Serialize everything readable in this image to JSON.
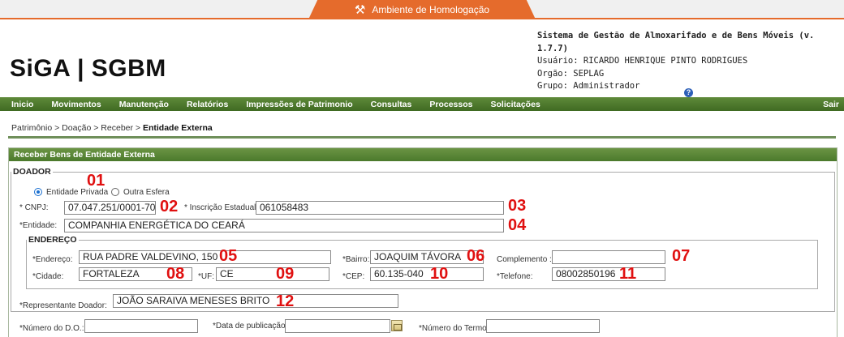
{
  "env_banner": "Ambiente de Homologação",
  "logo": "SiGA | SGBM",
  "system": {
    "title": "Sistema de Gestão de Almoxarifado e de Bens Móveis (v. 1.7.7)",
    "usuario": "Usuário: RICARDO HENRIQUE PINTO RODRIGUES",
    "orgao": "Orgão: SEPLAG",
    "grupo": "Grupo: Administrador"
  },
  "nav": [
    "Inicio",
    "Movimentos",
    "Manutenção",
    "Relatórios",
    "Impressões de Patrimonio",
    "Consultas",
    "Processos",
    "Solicitações"
  ],
  "nav_logout": "Sair",
  "breadcrumb": {
    "path": "Patrimônio  > Doação  > Receber > ",
    "current": "Entidade Externa"
  },
  "panel_title": "Receber Bens de Entidade Externa",
  "doador": {
    "legend": "DOADOR",
    "radio_privada": "Entidade Privada",
    "radio_outra": "Outra Esfera",
    "cnpj_label": "* CNPJ:",
    "cnpj": "07.047.251/0001-70",
    "ie_label": "* Inscrição Estadual:",
    "ie": "061058483",
    "entidade_label": "*Entidade:",
    "entidade": "COMPANHIA ENERGÉTICA DO CEARÁ",
    "representante_label": "*Representante Doador:",
    "representante": "JOÃO SARAIVA MENESES BRITO"
  },
  "endereco": {
    "legend": "ENDEREÇO",
    "endereco_label": "*Endereço:",
    "endereco": "RUA PADRE VALDEVINO, 150",
    "bairro_label": "*Bairro:",
    "bairro": "JOAQUIM TÁVORA",
    "complemento_label": "Complemento :",
    "complemento": "",
    "cidade_label": "*Cidade:",
    "cidade": "FORTALEZA",
    "uf_label": "*UF:",
    "uf": "CE",
    "cep_label": "*CEP:",
    "cep": "60.135-040",
    "telefone_label": "*Telefone:",
    "telefone": "08002850196"
  },
  "bottom": {
    "numero_do_label": "*Número do D.O.:",
    "data_publicacao_label": "*Data de publicação:",
    "numero_termo_label": "*Número do Termo:"
  },
  "markers": [
    "01",
    "02",
    "03",
    "04",
    "05",
    "06",
    "07",
    "08",
    "09",
    "10",
    "11",
    "12"
  ],
  "colors": {
    "accent": "#e56b2c",
    "nav_green": "#4f7a2e",
    "marker_red": "#e01010"
  }
}
